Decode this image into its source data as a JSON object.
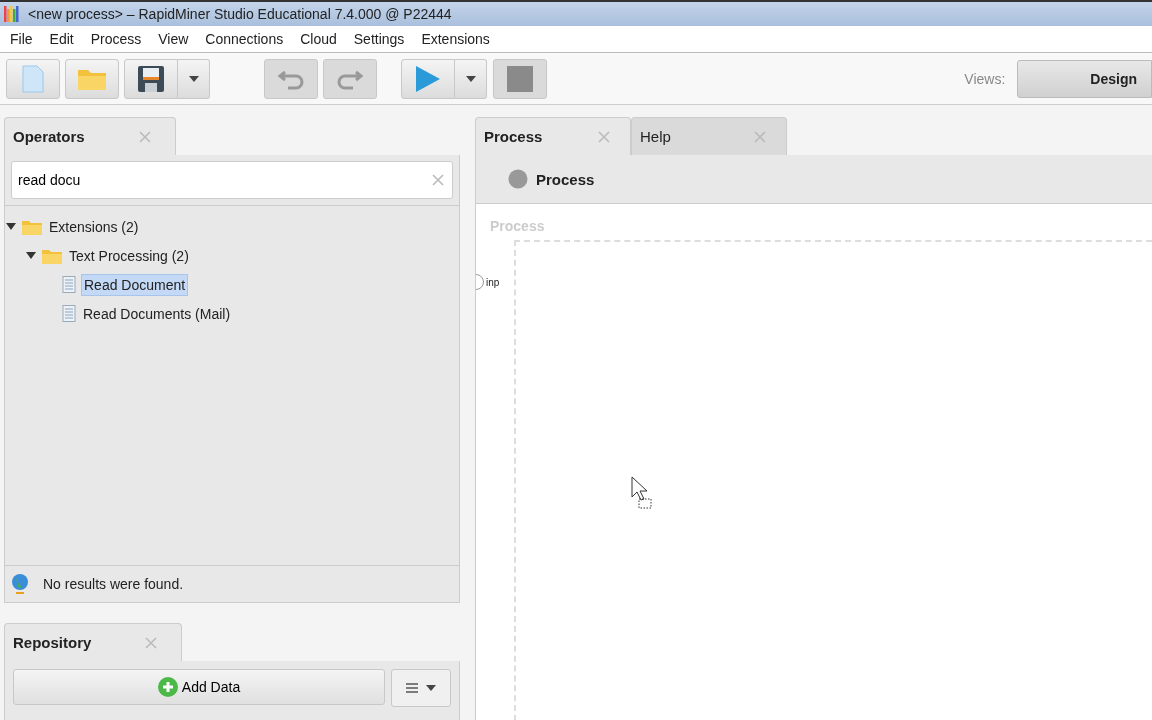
{
  "window": {
    "title": "<new process> – RapidMiner Studio Educational 7.4.000 @ P22444"
  },
  "menu": [
    "File",
    "Edit",
    "Process",
    "View",
    "Connections",
    "Cloud",
    "Settings",
    "Extensions"
  ],
  "toolbar": {
    "views_label": "Views:",
    "views": [
      {
        "label": "Design",
        "selected": true
      }
    ]
  },
  "operators": {
    "tabs": [
      {
        "label": "Operators",
        "selected": true
      }
    ],
    "search": {
      "value": "read docu"
    },
    "tree": [
      {
        "label": "Extensions (2)",
        "kind": "folder",
        "expanded": true,
        "selected": false,
        "children": [
          {
            "label": "Text Processing (2)",
            "kind": "folder",
            "expanded": true,
            "selected": false,
            "children": [
              {
                "label": "Read Document",
                "kind": "operator",
                "selected": true
              },
              {
                "label": "Read Documents (Mail)",
                "kind": "operator",
                "selected": false
              }
            ]
          }
        ]
      }
    ],
    "status": "No results were found."
  },
  "repository": {
    "tabs": [
      {
        "label": "Repository",
        "selected": true
      }
    ],
    "add_button": "Add Data"
  },
  "editor": {
    "tabs": [
      {
        "label": "Process",
        "selected": true
      },
      {
        "label": "Help",
        "selected": false
      }
    ],
    "breadcrumb": "Process",
    "canvas_title": "Process",
    "port": "inp"
  }
}
